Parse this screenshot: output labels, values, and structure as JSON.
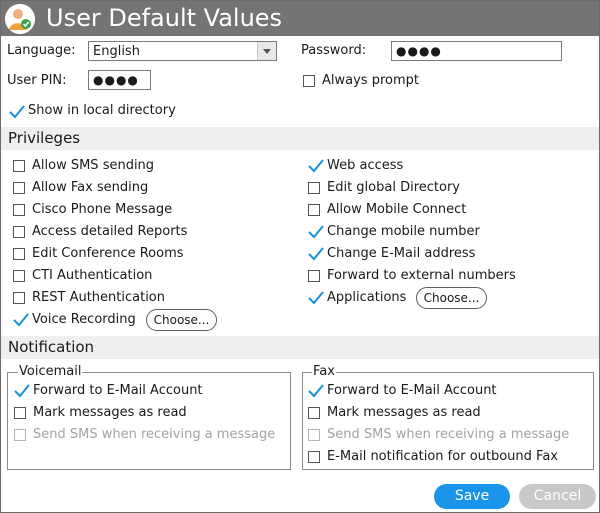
{
  "window": {
    "title": "User Default Values"
  },
  "general": {
    "language_label": "Language:",
    "language_value": "English",
    "password_label": "Password:",
    "password_value": "●●●●",
    "user_pin_label": "User PIN:",
    "user_pin_value": "●●●●",
    "always_prompt": {
      "label": "Always prompt",
      "checked": false
    },
    "show_local_dir": {
      "label": "Show in local directory",
      "checked": true
    }
  },
  "privileges": {
    "title": "Privileges",
    "left": [
      {
        "label": "Allow SMS sending",
        "checked": false
      },
      {
        "label": "Allow Fax sending",
        "checked": false
      },
      {
        "label": "Cisco Phone Message",
        "checked": false
      },
      {
        "label": "Access detailed Reports",
        "checked": false
      },
      {
        "label": "Edit Conference Rooms",
        "checked": false
      },
      {
        "label": "CTI Authentication",
        "checked": false
      },
      {
        "label": "REST Authentication",
        "checked": false
      },
      {
        "label": "Voice Recording",
        "checked": true
      }
    ],
    "right": [
      {
        "label": "Web access",
        "checked": true
      },
      {
        "label": "Edit global Directory",
        "checked": false
      },
      {
        "label": "Allow Mobile Connect",
        "checked": false
      },
      {
        "label": "Change mobile number",
        "checked": true
      },
      {
        "label": "Change E-Mail address",
        "checked": true
      },
      {
        "label": "Forward to external numbers",
        "checked": false
      },
      {
        "label": "Applications",
        "checked": true
      }
    ],
    "choose_label": "Choose..."
  },
  "notification": {
    "title": "Notification",
    "voicemail": {
      "legend": "Voicemail",
      "items": [
        {
          "label": "Forward to E-Mail Account",
          "checked": true,
          "disabled": false
        },
        {
          "label": "Mark messages as read",
          "checked": false,
          "disabled": false
        },
        {
          "label": "Send SMS when receiving a message",
          "checked": false,
          "disabled": true
        }
      ]
    },
    "fax": {
      "legend": "Fax",
      "items": [
        {
          "label": "Forward to E-Mail Account",
          "checked": true,
          "disabled": false
        },
        {
          "label": "Mark messages as read",
          "checked": false,
          "disabled": false
        },
        {
          "label": "Send SMS when receiving a message",
          "checked": false,
          "disabled": true
        },
        {
          "label": "E-Mail notification for outbound Fax",
          "checked": false,
          "disabled": false
        }
      ]
    }
  },
  "buttons": {
    "save": "Save",
    "cancel": "Cancel"
  },
  "colors": {
    "titlebar": "#747474",
    "accent": "#1a94e8",
    "check": "#1a8fe0",
    "section_bg": "#efefef"
  }
}
